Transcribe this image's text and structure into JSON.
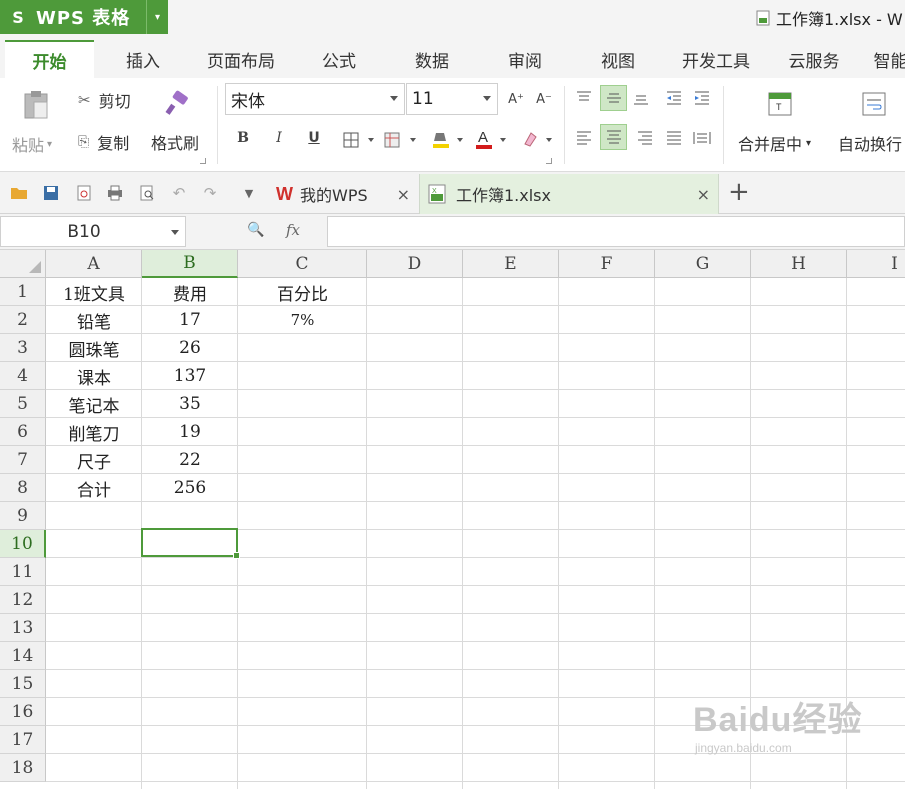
{
  "app": {
    "logo": "S",
    "name": "WPS 表格",
    "menu_arrow": "▾"
  },
  "window": {
    "title": "工作簿1.xlsx - W"
  },
  "ribbon_tabs": [
    "开始",
    "插入",
    "页面布局",
    "公式",
    "数据",
    "审阅",
    "视图",
    "开发工具",
    "云服务",
    "智能"
  ],
  "ribbon": {
    "paste": "粘贴",
    "cut": "剪切",
    "copy": "复制",
    "format_painter": "格式刷",
    "font_name": "宋体",
    "font_size": "11",
    "bold": "B",
    "italic": "I",
    "underline": "U",
    "grow_font": "A⁺",
    "shrink_font": "A⁻",
    "merge_center": "合并居中",
    "wrap_text": "自动换行"
  },
  "doc_tabs": [
    {
      "label": "我的WPS",
      "close": "×"
    },
    {
      "label": "工作簿1.xlsx",
      "close": "×"
    }
  ],
  "new_tab": "+",
  "formula_bar": {
    "name_box": "B10",
    "fx": "fx",
    "value": ""
  },
  "sheet": {
    "columns": [
      "A",
      "B",
      "C",
      "D",
      "E",
      "F",
      "G",
      "H",
      "I"
    ],
    "rows": [
      "1",
      "2",
      "3",
      "4",
      "5",
      "6",
      "7",
      "8",
      "9",
      "10",
      "11",
      "12",
      "13",
      "14",
      "15",
      "16",
      "17",
      "18"
    ],
    "selected_cell": "B10",
    "cells": [
      [
        "1班文具",
        "费用",
        "百分比"
      ],
      [
        "铅笔",
        "17",
        "7%"
      ],
      [
        "圆珠笔",
        "26",
        ""
      ],
      [
        "课本",
        "137",
        ""
      ],
      [
        "笔记本",
        "35",
        ""
      ],
      [
        "削笔刀",
        "19",
        ""
      ],
      [
        "尺子",
        "22",
        ""
      ],
      [
        "合计",
        "256",
        ""
      ]
    ]
  },
  "watermark": {
    "brand": "Baidu经验",
    "url": "jingyan.baidu.com"
  }
}
